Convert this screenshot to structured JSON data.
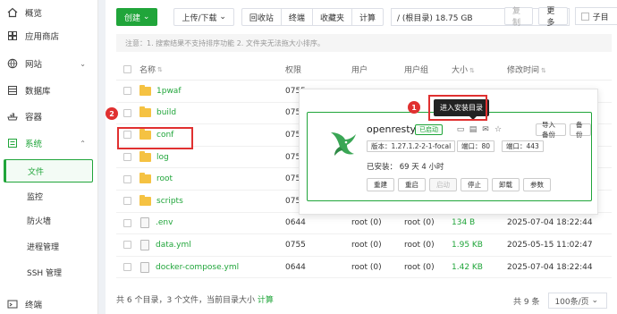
{
  "sidebar": {
    "items": [
      {
        "label": "概览",
        "icon": "home-icon"
      },
      {
        "label": "应用商店",
        "icon": "store-icon"
      },
      {
        "label": "网站",
        "icon": "globe-icon"
      },
      {
        "label": "数据库",
        "icon": "database-icon"
      },
      {
        "label": "容器",
        "icon": "container-icon"
      },
      {
        "label": "系统",
        "icon": "system-icon"
      }
    ],
    "subitems": [
      "文件",
      "监控",
      "防火墙",
      "进程管理",
      "SSH 管理"
    ],
    "bottom": {
      "label": "终端",
      "icon": "terminal-icon"
    }
  },
  "toolbar": {
    "create": "创建",
    "upload": "上传/下载",
    "recycle": "回收站",
    "terminal": "终端",
    "favorites": "收藏夹",
    "calculate": "计算",
    "path": "/ (根目录) 18.75 GB",
    "copy": "复制",
    "more": "更多",
    "subdir": "子目"
  },
  "notice": "注意：1. 搜索结果不支持排序功能 2. 文件夹无法拖大小排序。",
  "table": {
    "headers": {
      "name": "名称",
      "perm": "权限",
      "user": "用户",
      "group": "用户组",
      "size": "大小",
      "time": "修改时间"
    },
    "rows": [
      {
        "name": "1pwaf",
        "type": "folder",
        "perm": "0755",
        "user": "",
        "group": "",
        "size": "",
        "time": ""
      },
      {
        "name": "build",
        "type": "folder",
        "perm": "0755",
        "user": "",
        "group": "",
        "size": "",
        "time": ""
      },
      {
        "name": "conf",
        "type": "folder",
        "perm": "0755",
        "user": "",
        "group": "",
        "size": "",
        "time": ""
      },
      {
        "name": "log",
        "type": "folder",
        "perm": "0755",
        "user": "",
        "group": "",
        "size": "",
        "time": ""
      },
      {
        "name": "root",
        "type": "folder",
        "perm": "0755",
        "user": "",
        "group": "",
        "size": "",
        "time": ""
      },
      {
        "name": "scripts",
        "type": "folder",
        "perm": "0755",
        "user": "",
        "group": "",
        "size": "",
        "time": ""
      },
      {
        "name": ".env",
        "type": "file",
        "perm": "0644",
        "user": "root (0)",
        "group": "root (0)",
        "size": "134 B",
        "time": "2025-07-04 18:22:44"
      },
      {
        "name": "data.yml",
        "type": "file",
        "perm": "0755",
        "user": "root (0)",
        "group": "root (0)",
        "size": "1.95 KB",
        "time": "2025-05-15 11:02:47"
      },
      {
        "name": "docker-compose.yml",
        "type": "file",
        "perm": "0644",
        "user": "root (0)",
        "group": "root (0)",
        "size": "1.42 KB",
        "time": "2025-07-04 18:22:44"
      }
    ]
  },
  "footer": {
    "summary": "共 6 个目录，3 个文件，当前目录大小",
    "calc": "计算",
    "total": "共 9 条",
    "page_size": "100条/页"
  },
  "popup": {
    "app_name": "openresty",
    "status": "已启动",
    "version": "版本：1.27.1.2-2-1-focal",
    "http_port": "端口：80",
    "https_port": "端口：443",
    "installed": "已安装：  69 天 4 小时",
    "import_backup": "导入备份",
    "backup": "备份",
    "actions": [
      "重建",
      "重启",
      "启动",
      "停止",
      "卸载",
      "参数"
    ],
    "tooltip": "进入安装目录"
  },
  "markers": {
    "one": "1",
    "two": "2"
  },
  "colors": {
    "accent": "#20a53a",
    "highlight": "#e03030"
  }
}
